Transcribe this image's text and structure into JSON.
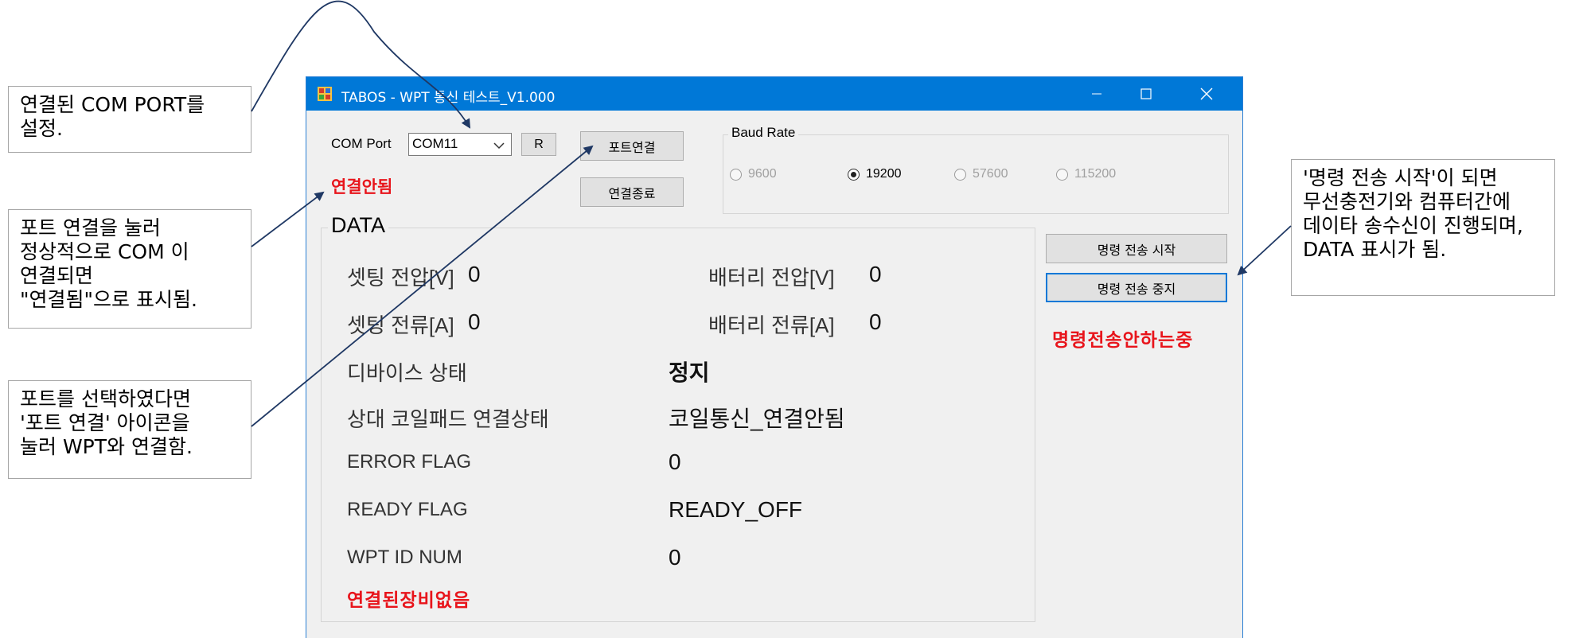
{
  "notes": {
    "com_port": "연결된 COM PORT를\n 설정.",
    "connect_status": "포트 연결을 눌러\n정상적으로 COM 이\n연결되면\n\"연결됨\"으로 표시됨.",
    "port_connect": "포트를 선택하였다면\n'포트 연결' 아이콘을\n눌러 WPT와 연결함.",
    "command_start": "'명령 전송 시작'이 되면\n 무선충전기와  컴퓨터간에\n 데이타 송수신이 진행되며,\nDATA 표시가 됨."
  },
  "window": {
    "title": "TABOS - WPT 통신 테스트_V1.000",
    "title_icon": "app-icon",
    "controls": [
      "minimize-icon",
      "maximize-icon",
      "close-icon"
    ]
  },
  "port": {
    "label": "COM Port",
    "selected": "COM11",
    "refresh_label": "R",
    "connect_label": "포트연결",
    "disconnect_label": "연결종료",
    "status": "연결안됨"
  },
  "baud": {
    "title": "Baud Rate",
    "options": [
      "9600",
      "19200",
      "57600",
      "115200"
    ],
    "selected": "19200"
  },
  "commands": {
    "start_label": "명령 전송 시작",
    "stop_label": "명령 전송 중지",
    "status": "명령전송안하는중"
  },
  "data": {
    "title": "DATA",
    "set_voltage_label": "셋팅 전압[V]",
    "set_voltage": "0",
    "battery_voltage_label": "배터리 전압[V]",
    "battery_voltage": "0",
    "set_current_label": "셋팅 전류[A]",
    "set_current": "0",
    "battery_current_label": "배터리 전류[A]",
    "battery_current": "0",
    "device_state_label": "디바이스 상태",
    "device_state": "정지",
    "coil_pad_label": "상대 코일패드 연결상태",
    "coil_pad": "코일통신_연결안됨",
    "error_flag_label": "ERROR FLAG",
    "error_flag": "0",
    "ready_flag_label": "READY FLAG",
    "ready_flag": "READY_OFF",
    "wpt_id_label": "WPT ID NUM",
    "wpt_id": "0",
    "device_status": "연결된장비없음"
  },
  "colors": {
    "titlebar": "#0078d7",
    "alert": "#e8141b",
    "annotation_arrow": "#1f3864"
  }
}
